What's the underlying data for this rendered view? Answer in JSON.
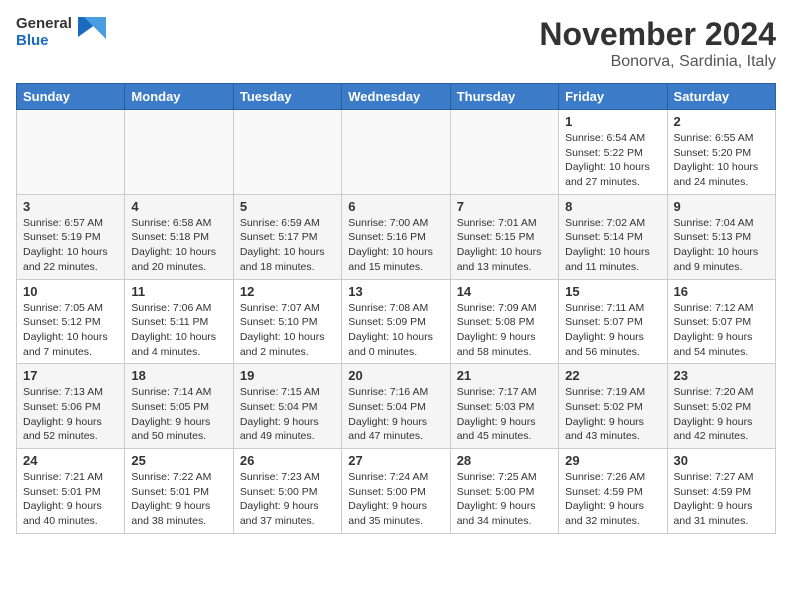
{
  "header": {
    "logo_general": "General",
    "logo_blue": "Blue",
    "month_title": "November 2024",
    "location": "Bonorva, Sardinia, Italy"
  },
  "weekdays": [
    "Sunday",
    "Monday",
    "Tuesday",
    "Wednesday",
    "Thursday",
    "Friday",
    "Saturday"
  ],
  "weeks": [
    [
      {
        "day": "",
        "info": ""
      },
      {
        "day": "",
        "info": ""
      },
      {
        "day": "",
        "info": ""
      },
      {
        "day": "",
        "info": ""
      },
      {
        "day": "",
        "info": ""
      },
      {
        "day": "1",
        "info": "Sunrise: 6:54 AM\nSunset: 5:22 PM\nDaylight: 10 hours and 27 minutes."
      },
      {
        "day": "2",
        "info": "Sunrise: 6:55 AM\nSunset: 5:20 PM\nDaylight: 10 hours and 24 minutes."
      }
    ],
    [
      {
        "day": "3",
        "info": "Sunrise: 6:57 AM\nSunset: 5:19 PM\nDaylight: 10 hours and 22 minutes."
      },
      {
        "day": "4",
        "info": "Sunrise: 6:58 AM\nSunset: 5:18 PM\nDaylight: 10 hours and 20 minutes."
      },
      {
        "day": "5",
        "info": "Sunrise: 6:59 AM\nSunset: 5:17 PM\nDaylight: 10 hours and 18 minutes."
      },
      {
        "day": "6",
        "info": "Sunrise: 7:00 AM\nSunset: 5:16 PM\nDaylight: 10 hours and 15 minutes."
      },
      {
        "day": "7",
        "info": "Sunrise: 7:01 AM\nSunset: 5:15 PM\nDaylight: 10 hours and 13 minutes."
      },
      {
        "day": "8",
        "info": "Sunrise: 7:02 AM\nSunset: 5:14 PM\nDaylight: 10 hours and 11 minutes."
      },
      {
        "day": "9",
        "info": "Sunrise: 7:04 AM\nSunset: 5:13 PM\nDaylight: 10 hours and 9 minutes."
      }
    ],
    [
      {
        "day": "10",
        "info": "Sunrise: 7:05 AM\nSunset: 5:12 PM\nDaylight: 10 hours and 7 minutes."
      },
      {
        "day": "11",
        "info": "Sunrise: 7:06 AM\nSunset: 5:11 PM\nDaylight: 10 hours and 4 minutes."
      },
      {
        "day": "12",
        "info": "Sunrise: 7:07 AM\nSunset: 5:10 PM\nDaylight: 10 hours and 2 minutes."
      },
      {
        "day": "13",
        "info": "Sunrise: 7:08 AM\nSunset: 5:09 PM\nDaylight: 10 hours and 0 minutes."
      },
      {
        "day": "14",
        "info": "Sunrise: 7:09 AM\nSunset: 5:08 PM\nDaylight: 9 hours and 58 minutes."
      },
      {
        "day": "15",
        "info": "Sunrise: 7:11 AM\nSunset: 5:07 PM\nDaylight: 9 hours and 56 minutes."
      },
      {
        "day": "16",
        "info": "Sunrise: 7:12 AM\nSunset: 5:07 PM\nDaylight: 9 hours and 54 minutes."
      }
    ],
    [
      {
        "day": "17",
        "info": "Sunrise: 7:13 AM\nSunset: 5:06 PM\nDaylight: 9 hours and 52 minutes."
      },
      {
        "day": "18",
        "info": "Sunrise: 7:14 AM\nSunset: 5:05 PM\nDaylight: 9 hours and 50 minutes."
      },
      {
        "day": "19",
        "info": "Sunrise: 7:15 AM\nSunset: 5:04 PM\nDaylight: 9 hours and 49 minutes."
      },
      {
        "day": "20",
        "info": "Sunrise: 7:16 AM\nSunset: 5:04 PM\nDaylight: 9 hours and 47 minutes."
      },
      {
        "day": "21",
        "info": "Sunrise: 7:17 AM\nSunset: 5:03 PM\nDaylight: 9 hours and 45 minutes."
      },
      {
        "day": "22",
        "info": "Sunrise: 7:19 AM\nSunset: 5:02 PM\nDaylight: 9 hours and 43 minutes."
      },
      {
        "day": "23",
        "info": "Sunrise: 7:20 AM\nSunset: 5:02 PM\nDaylight: 9 hours and 42 minutes."
      }
    ],
    [
      {
        "day": "24",
        "info": "Sunrise: 7:21 AM\nSunset: 5:01 PM\nDaylight: 9 hours and 40 minutes."
      },
      {
        "day": "25",
        "info": "Sunrise: 7:22 AM\nSunset: 5:01 PM\nDaylight: 9 hours and 38 minutes."
      },
      {
        "day": "26",
        "info": "Sunrise: 7:23 AM\nSunset: 5:00 PM\nDaylight: 9 hours and 37 minutes."
      },
      {
        "day": "27",
        "info": "Sunrise: 7:24 AM\nSunset: 5:00 PM\nDaylight: 9 hours and 35 minutes."
      },
      {
        "day": "28",
        "info": "Sunrise: 7:25 AM\nSunset: 5:00 PM\nDaylight: 9 hours and 34 minutes."
      },
      {
        "day": "29",
        "info": "Sunrise: 7:26 AM\nSunset: 4:59 PM\nDaylight: 9 hours and 32 minutes."
      },
      {
        "day": "30",
        "info": "Sunrise: 7:27 AM\nSunset: 4:59 PM\nDaylight: 9 hours and 31 minutes."
      }
    ]
  ]
}
